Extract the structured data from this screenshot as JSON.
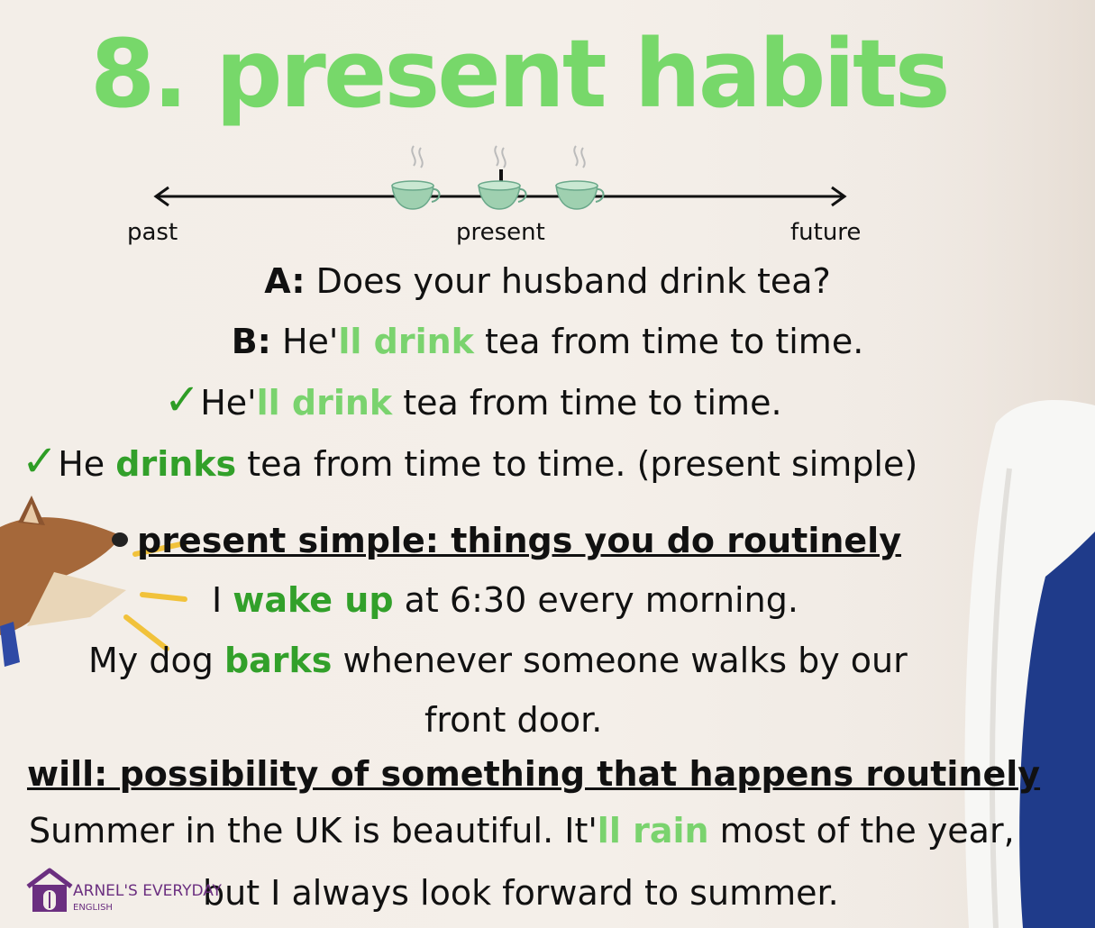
{
  "title": "8. present habits",
  "timeline": {
    "past": "past",
    "present": "present",
    "future": "future"
  },
  "dialogue": {
    "a_label": "A:",
    "a_text": " Does your husband drink tea?",
    "b_label": "B:",
    "b_pre": " He'",
    "b_verb": "ll drink",
    "b_post": " tea from time to time."
  },
  "correct1": {
    "check": "✓",
    "pre": "He'",
    "verb": "ll drink",
    "post": " tea from time to time."
  },
  "correct2": {
    "check": "✓",
    "pre": "He ",
    "verb": "drinks",
    "post": " tea from time to time. (present simple)"
  },
  "present_simple": {
    "heading": "present simple: things you do routinely",
    "ex1_pre": "I ",
    "ex1_verb": "wake up",
    "ex1_post": " at 6:30 every morning.",
    "ex2_pre": "My dog ",
    "ex2_verb": "barks",
    "ex2_post": " whenever someone walks by our",
    "ex2_line2": "front door."
  },
  "will": {
    "heading": "will: possibility of something that happens routinely",
    "ex1_pre": "Summer in the UK is beautiful. It'",
    "ex1_verb": "ll rain",
    "ex1_post": " most of the year,",
    "ex1_line2": "but I always look forward to summer."
  },
  "logo": {
    "name": "ARNEL'S EVERYDAY",
    "sub": "ENGLISH"
  },
  "colors": {
    "title": "#77d86a",
    "highlight": "#7ad36e",
    "check": "#2e9d25",
    "logo": "#6b2f80"
  }
}
